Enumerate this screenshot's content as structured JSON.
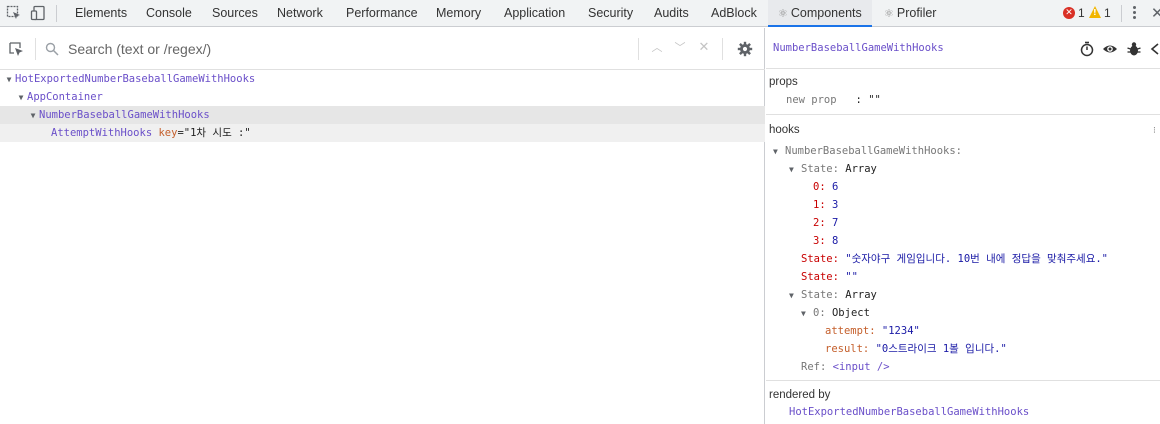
{
  "toolbar": {
    "tabs": [
      "Elements",
      "Console",
      "Sources",
      "Network",
      "Performance",
      "Memory",
      "Application",
      "Security",
      "Audits",
      "AdBlock",
      "Components",
      "Profiler"
    ],
    "active_tab": "Components",
    "error_count": "1",
    "warning_count": "1",
    "colors": {
      "accent": "#1a73e8",
      "error": "#d93025",
      "warning": "#f2b600"
    }
  },
  "search": {
    "placeholder": "Search (text or /regex/)",
    "value": ""
  },
  "tree": [
    {
      "name": "HotExportedNumberBaseballGameWithHooks",
      "expanded": true,
      "depth": 0
    },
    {
      "name": "AppContainer",
      "expanded": true,
      "depth": 1
    },
    {
      "name": "NumberBaseballGameWithHooks",
      "expanded": true,
      "depth": 2,
      "selected": true
    },
    {
      "name": "AttemptWithHooks",
      "depth": 3,
      "key_label": "key",
      "key_value": "\"1차 시도 :\""
    }
  ],
  "inspector": {
    "title": "NumberBaseballGameWithHooks",
    "props_title": "props",
    "new_prop_label": "new prop",
    "new_prop_value": ": \"\"",
    "hooks_title": "hooks",
    "hook_owner": "NumberBaseballGameWithHooks:",
    "state1_label": "State:",
    "state1_type": "Array",
    "state1_items": [
      {
        "index": "0:",
        "value": "6"
      },
      {
        "index": "1:",
        "value": "3"
      },
      {
        "index": "2:",
        "value": "7"
      },
      {
        "index": "3:",
        "value": "8"
      }
    ],
    "state2_label": "State:",
    "state2_value": "\"숫자야구 게임입니다. 10번 내에 정답을 맞춰주세요.\"",
    "state3_label": "State:",
    "state3_value": "\"\"",
    "state4_label": "State:",
    "state4_type": "Array",
    "state4_item_index": "0:",
    "state4_item_type": "Object",
    "attempt_label": "attempt:",
    "attempt_value": "\"1234\"",
    "result_label": "result:",
    "result_value": "\"0스트라이크 1볼 입니다.\"",
    "ref_label": "Ref:",
    "ref_value": "<input />",
    "rendered_by_title": "rendered by",
    "rendered_by_value": "HotExportedNumberBaseballGameWithHooks"
  }
}
